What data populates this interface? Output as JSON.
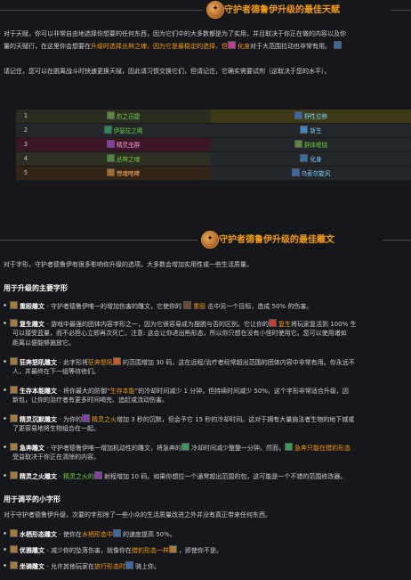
{
  "section1": {
    "title": "守护者德鲁伊升级的最佳天赋",
    "para1_line1": "对于天赋，你可以非常自由地选择你想要的任何东西，因为它们中的大多数都是为了实用，并且取决于你正在做的内容以及你",
    "para1_line2_a": "量的天赋行，在这里你会想要在",
    "para1_line2_b": "升级时选择丛林之魂，因为它是最稳定的选择，但",
    "para1_line2_c": "化身",
    "para1_line2_d": "对于大范围拉动也非常有用。",
    "para2": "请记住，您可以在脱离战斗时快速更换天赋，因此请习惯交换它们，但请记住，它确实需要试剂（这取决于您的水平）。",
    "talents": [
      {
        "level": "1",
        "left": "豹之迅捷",
        "right": "野性位移"
      },
      {
        "level": "2",
        "left": "伊瑟拉之赐",
        "right": "新生"
      },
      {
        "level": "3",
        "left": "精灵虫群",
        "right": "群体缠绕"
      },
      {
        "level": "4",
        "left": "丛林之魂",
        "right": "化身"
      },
      {
        "level": "5",
        "left": "惊魂咆哮",
        "right": "乌索尔旋风"
      }
    ]
  },
  "section2": {
    "title": "守护者德鲁伊升级的最佳雕文",
    "intro": "对于字形，守护者德鲁伊有很多影响你升级的选项。大多数会增加实用性或一些生活质量。",
    "major_heading": "用于升级的主要字形",
    "major": [
      {
        "line1_a": "重殴雕文",
        "line1_b": " - 守护者德鲁伊唯一的增加伤害的雕文，它使你的 ",
        "line1_c": "重殴",
        "line1_d": " 击中另一个目标，造成 50% 的伤害。"
      },
      {
        "line1_a": "复生雕文",
        "line1_b": " - 游戏中最强的团体内容字形之一，因为它很容易成为摆脱与否的区别。它让你的",
        "line1_c": "复生",
        "line1_d": "将玩家复活到 100% 生",
        "line2": "可以接受蓝量，而不必担心立即再次死亡。注意: 这会让你进出熊形态，所以你只想在没有小怪时使用它。您可以使用诸如",
        "line3": "距离以便能够施放它。"
      },
      {
        "line1_a": "狂奔怒吼雕文",
        "line1_b": " - 此字形将",
        "line1_c": "狂奔怒吼",
        "line1_d": "的范围增加 30 码，这在远程/治疗者经常超出范围的团体内容中非常有用。你永远不",
        "line2": "人，并最终在下一组等待他们。"
      },
      {
        "line1_a": "生存本能雕文",
        "line1_b": " - 将你最大的防御“",
        "line1_c": "生存本能",
        "line1_d": "”的冷却时间减少 1 分钟，但持续时间减少 50%。这个字形非常适合升级，因",
        "line2": "新包，让你的治疗者有更多时间喝完、追赶或流动伤害。"
      },
      {
        "line1_a": "精灵沉默雕文",
        "line1_b": " - 为你的",
        "line1_c": "精灵之火",
        "line1_d": "增加 3 秒的沉默，但会予它 15 秒的冷却时间。这对于拥有大量施法者生物的地下城或",
        "line2": "了更容易地将生物组合在一起。"
      },
      {
        "line1_a": "急奔雕文",
        "line1_b": " - 守护者德鲁伊唯一增加机动性的雕文，将急奔的",
        "line1_c": "冷却时间减少整整一分钟。然而，",
        "line1_d": "急奔只能在猎豹形态",
        "line2": "受益取决于你正在清除的内容。"
      },
      {
        "line1_a": "精灵之火雕文",
        "line1_b": " - 精灵之火的",
        "line1_c": "射程增加 10 码。",
        "line1_d": "如果你想拉一个通常超出范围的包，这可能是一个不错的范围修改器。"
      }
    ],
    "minor_heading": "用于调平的小字形",
    "minor_intro": "对于守护者德鲁伊升级，次要的字形除了一些小众的生活质量改进之外并没有真正带来任何东西。",
    "minor": [
      {
        "a": "水栖形态雕文",
        "b": " - 使你在",
        "c": "水栖形态中",
        "d": "的速度提高 50%。"
      },
      {
        "a": "优雅雕文",
        "b": " - 减少你的坠落伤害，就像你在",
        "c": "猎豹形态一样",
        "d": "，即使你不是。"
      },
      {
        "a": "坐骑雕文",
        "b": " - 允许其他玩家在",
        "c": "旅行形态时",
        "d": "骑上你。"
      }
    ]
  },
  "colors": {
    "accent": "#f39c12",
    "green": "#6fcf3f",
    "background": "#15171a"
  }
}
